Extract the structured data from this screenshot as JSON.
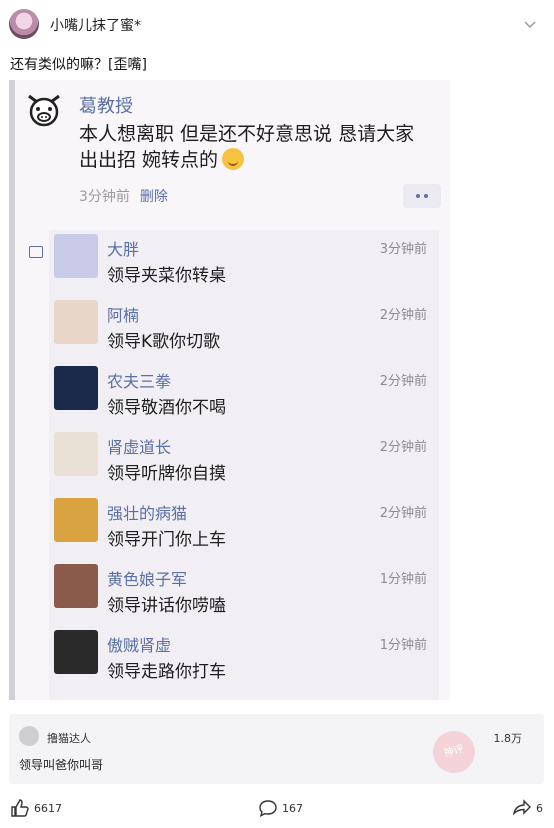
{
  "post": {
    "username": "小嘴儿抹了蜜*",
    "text": "还有类似的嘛？[歪嘴]"
  },
  "screenshot": {
    "author": "葛教授",
    "body_line1": "本人想离职 但是还不好意思说 恳请大家",
    "body_line2": "出出招 婉转点的",
    "time": "3分钟前",
    "delete_label": "删除",
    "comments": [
      {
        "name": "大胖",
        "time": "3分钟前",
        "text": "领导夹菜你转桌",
        "avatar_color": "#c9c9e8"
      },
      {
        "name": "阿楠",
        "time": "2分钟前",
        "text": "领导K歌你切歌",
        "avatar_color": "#e8d7c8"
      },
      {
        "name": "农夫三拳",
        "time": "2分钟前",
        "text": "领导敬酒你不喝",
        "avatar_color": "#1b2a4a"
      },
      {
        "name": "肾虚道长",
        "time": "2分钟前",
        "text": "领导听牌你自摸",
        "avatar_color": "#e9e1d6"
      },
      {
        "name": "强壮的病猫",
        "time": "2分钟前",
        "text": "领导开门你上车",
        "avatar_color": "#d9a341"
      },
      {
        "name": "黄色娘子军",
        "time": "1分钟前",
        "text": "领导讲话你唠嗑",
        "avatar_color": "#8a5a4a"
      },
      {
        "name": "傲贼肾虚",
        "time": "1分钟前",
        "text": "领导走路你打车",
        "avatar_color": "#2a2a2a"
      }
    ]
  },
  "reply": {
    "name": "撸猫达人",
    "text": "领导叫爸你叫哥",
    "likes": "1.8万",
    "stamp": "神评"
  },
  "actions": {
    "likes": "6617",
    "comments": "167",
    "shares": "6"
  },
  "colors": {
    "link_blue": "#5a6fa6",
    "time_gray": "#8c8c90"
  }
}
